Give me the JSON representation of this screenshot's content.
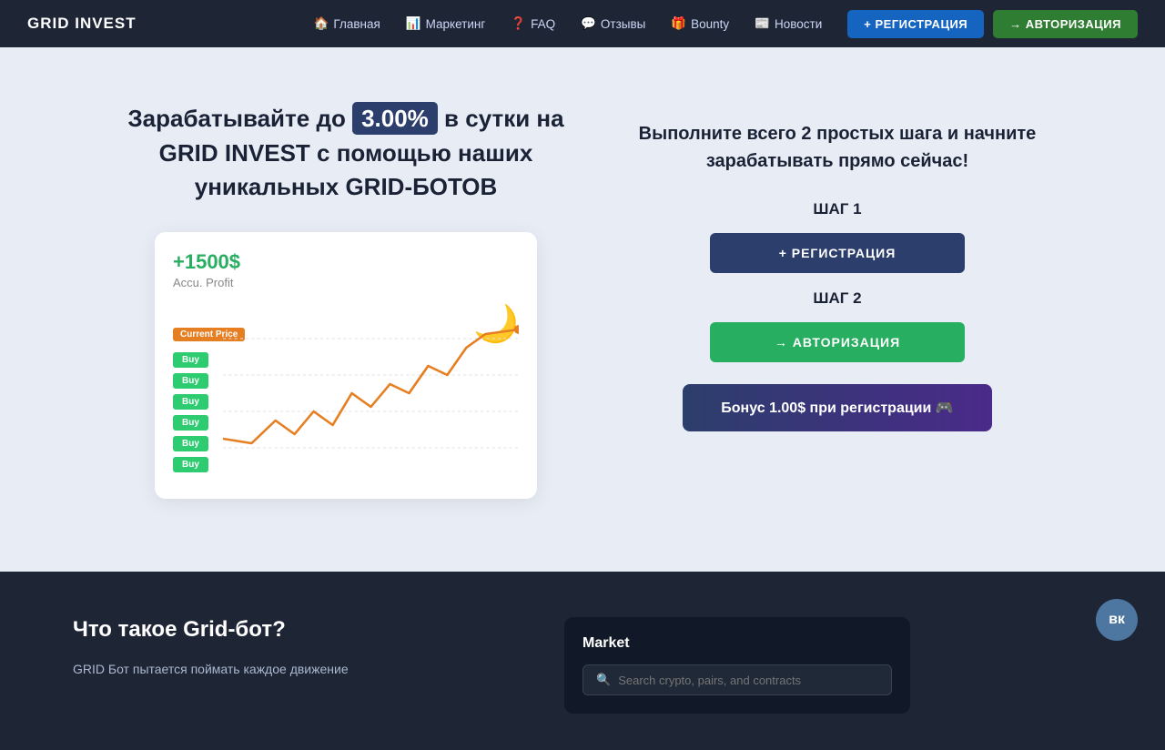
{
  "brand": "GRID INVEST",
  "nav": {
    "links": [
      {
        "id": "home",
        "icon": "🏠",
        "label": "Главная"
      },
      {
        "id": "marketing",
        "icon": "📊",
        "label": "Маркетинг"
      },
      {
        "id": "faq",
        "icon": "❓",
        "label": "FAQ"
      },
      {
        "id": "reviews",
        "icon": "💬",
        "label": "Отзывы"
      },
      {
        "id": "bounty",
        "icon": "🎁",
        "label": "Bounty"
      },
      {
        "id": "news",
        "icon": "📰",
        "label": "Новости"
      }
    ],
    "register_btn": "+ РЕГИСТРАЦИЯ",
    "auth_btn": "→ АВТОРИЗАЦИЯ"
  },
  "hero": {
    "title_pre": "Зарабатывайте до",
    "rate": "3.00%",
    "title_post": "в сутки на GRID INVEST с помощью наших уникальных GRID-БОТОВ",
    "chart": {
      "profit": "+1500$",
      "profit_label": "Accu. Profit",
      "current_price": "Current Price",
      "moon": "🌙",
      "buy_labels": [
        "Buy",
        "Buy",
        "Buy",
        "Buy",
        "Buy",
        "Buy"
      ]
    },
    "right": {
      "subtitle": "Выполните всего 2 простых шага и начните зарабатывать прямо сейчас!",
      "step1": "ШАГ 1",
      "step1_btn": "+ РЕГИСТРАЦИЯ",
      "step2": "ШАГ 2",
      "step2_btn": "→ АВТОРИЗАЦИЯ",
      "bonus_btn": "Бонус 1.00$ при регистрации 🎮"
    }
  },
  "footer": {
    "title": "Что такое Grid-бот?",
    "text": "GRID Бот пытается поймать каждое движение",
    "market": {
      "title": "Market",
      "search_placeholder": "Search crypto, pairs, and contracts"
    }
  },
  "vk_btn": "вк"
}
